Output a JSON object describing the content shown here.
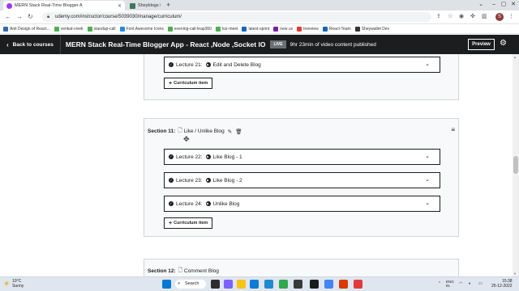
{
  "browser": {
    "tabs": [
      {
        "title": "MERN Stack Real-Time Blogger A",
        "active": true
      },
      {
        "title": "Sheyblogs Dev",
        "active": false
      }
    ],
    "url": "udemy.com/instructor/course/5039030/manage/curriculum/",
    "bookmarks": [
      {
        "label": "Anit Design of React...",
        "color": "#2b6cb0"
      },
      {
        "label": "venkat-vivek",
        "color": "#4caf50"
      },
      {
        "label": "standup-call",
        "color": "#4caf50"
      },
      {
        "label": "Font Awesome Icons",
        "color": "#228ae6"
      },
      {
        "label": "evening-call-leap360",
        "color": "#4caf50"
      },
      {
        "label": "ksr-meet",
        "color": "#4caf50"
      },
      {
        "label": "latest-sprint",
        "color": "#1565c0"
      },
      {
        "label": "new ux",
        "color": "#7b1fa2"
      },
      {
        "label": "treeview",
        "color": "#e53935"
      },
      {
        "label": "React-Team",
        "color": "#1565c0"
      },
      {
        "label": "Sheywallet Dev",
        "color": "#333333"
      }
    ],
    "profile_initial": "S"
  },
  "header": {
    "back_label": "Back to courses",
    "course_title": "MERN Stack Real-Time Blogger App - React ,Node ,Socket IO",
    "live_badge": "LIVE",
    "publish_note": "9hr 23min of video content published",
    "preview_label": "Preview"
  },
  "curriculum": {
    "top_lecture": {
      "label": "Lecture 21:",
      "title": "Edit and Delete Blog"
    },
    "add_button_label": "Curriculum item",
    "section11": {
      "label": "Section 11:",
      "title": "Like / Unlike Blog",
      "lectures": [
        {
          "label": "Lecture 22:",
          "title": "Like Blog - 1"
        },
        {
          "label": "Lecture 23:",
          "title": "Like Blog - 2"
        },
        {
          "label": "Lecture 24:",
          "title": "Unlike Blog"
        }
      ]
    },
    "section12": {
      "label": "Section 12:",
      "title": "Comment Blog"
    }
  },
  "taskbar": {
    "weather_temp": "19°C",
    "weather_desc": "Sunny",
    "search_label": "Search",
    "lang_line1": "ENG",
    "lang_line2": "IN",
    "time": "15:38",
    "date": "25-12-2022"
  },
  "colors": {
    "accent_dark": "#1c1d1f",
    "section_bg": "#f7f9fa",
    "border": "#d1d7dc"
  }
}
